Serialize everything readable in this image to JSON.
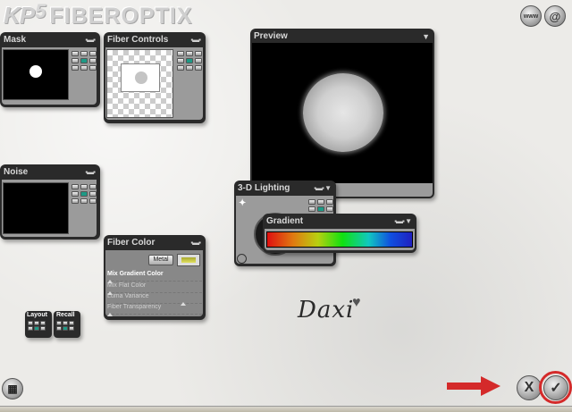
{
  "app": {
    "logo_kp": "KP",
    "logo_version": "5",
    "logo_name": "FIBEROPTIX"
  },
  "top_right": {
    "web_button": "www",
    "help_button": "@"
  },
  "panels": {
    "mask": {
      "title": "Mask"
    },
    "fiber_controls": {
      "title": "Fiber Controls"
    },
    "noise": {
      "title": "Noise"
    },
    "preview": {
      "title": "Preview"
    },
    "lighting": {
      "title": "3-D Lighting"
    },
    "gradient": {
      "title": "Gradient"
    },
    "fiber_color": {
      "title": "Fiber Color",
      "metal_button": "Metal",
      "sliders": [
        "Mix Gradient Color",
        "Mix Flat Color",
        "Luma Variance",
        "Fiber Transparency"
      ]
    }
  },
  "bottom_left": {
    "layout_label": "Layout",
    "recall_label": "Recall"
  },
  "signature": "Daxi",
  "actions": {
    "cancel": "X",
    "ok": "✓"
  },
  "colors": {
    "accent_red": "#d42a2a",
    "panel": "#2a2a2a",
    "teal": "#1e9a86"
  }
}
